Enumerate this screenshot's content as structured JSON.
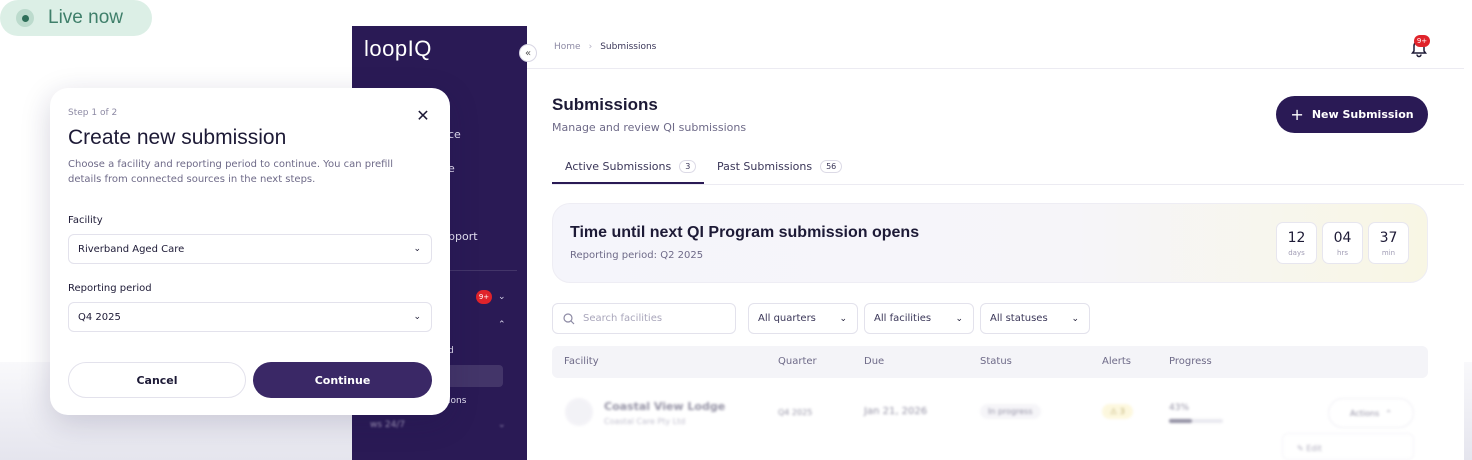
{
  "live_pill": {
    "label": "Live now"
  },
  "sidebar": {
    "logo": "loopIQ",
    "collapse_glyph": "«",
    "fragments": [
      "ce",
      "e",
      "pport",
      "d",
      "ions",
      "ws 24/7"
    ],
    "badge": "9+"
  },
  "header": {
    "breadcrumb": [
      "Home",
      "Submissions"
    ],
    "breadcrumb_sep": "›",
    "notification_badge": "9+"
  },
  "page": {
    "title": "Submissions",
    "subtitle": "Manage and review QI submissions",
    "new_button": "New Submission"
  },
  "tabs": [
    {
      "label": "Active Submissions",
      "count": "3"
    },
    {
      "label": "Past Submissions",
      "count": "56"
    }
  ],
  "timer": {
    "title": "Time until next QI Program submission opens",
    "subtitle": "Reporting period: Q2 2025",
    "boxes": [
      {
        "value": "12",
        "unit": "days"
      },
      {
        "value": "04",
        "unit": "hrs"
      },
      {
        "value": "37",
        "unit": "min"
      }
    ]
  },
  "filters": {
    "search_placeholder": "Search facilities",
    "dropdowns": [
      "All quarters",
      "All facilities",
      "All statuses"
    ]
  },
  "table": {
    "headers": [
      "Facility",
      "Quarter",
      "Due",
      "Status",
      "Alerts",
      "Progress"
    ],
    "rows": [
      {
        "name": "Coastal View Lodge",
        "org": "Coastal Care Pty Ltd",
        "quarter": "Q4 2025",
        "due": "Jan 21, 2026",
        "status": "In progress",
        "alerts": "3",
        "progress_label": "43%",
        "progress": 0.43,
        "actions": "Actions",
        "menu_item": "Edit"
      }
    ]
  },
  "modal": {
    "step": "Step 1 of 2",
    "title": "Create new submission",
    "description": "Choose a facility and reporting period to continue. You can prefill details from connected sources in the next steps.",
    "facility_label": "Facility",
    "facility_value": "Riverband Aged Care",
    "period_label": "Reporting period",
    "period_value": "Q4 2025",
    "cancel": "Cancel",
    "continue": "Continue"
  },
  "colors": {
    "brand": "#2a1a55",
    "live_bg": "#dcefe6",
    "badge": "#e0232b"
  },
  "icons": [
    "live-indicator-icon",
    "collapse-icon",
    "bell-icon",
    "plus-icon",
    "search-icon",
    "chevron-down-icon",
    "close-icon",
    "building-icon",
    "alert-icon",
    "edit-icon"
  ]
}
